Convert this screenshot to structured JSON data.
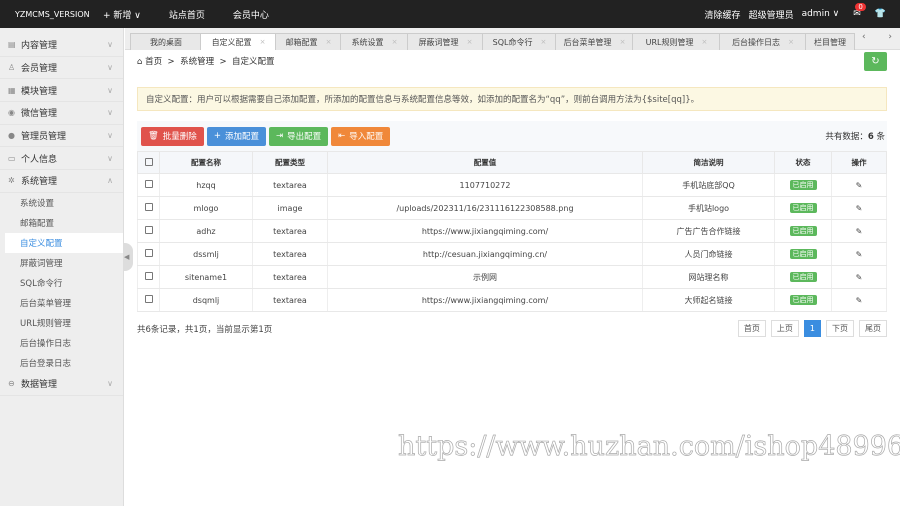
{
  "topbar": {
    "brand": "YZMCMS_VERSION",
    "new_label": "+ 新增 ∨",
    "nav": [
      "站点首页",
      "会员中心"
    ],
    "clear_cache": "清除缓存",
    "role": "超级管理员",
    "user": "admin ∨",
    "msg_count": "0"
  },
  "sidebar": {
    "items": [
      {
        "label": "内容管理",
        "icon": "doc-icon"
      },
      {
        "label": "会员管理",
        "icon": "user-icon"
      },
      {
        "label": "模块管理",
        "icon": "grid-icon"
      },
      {
        "label": "微信管理",
        "icon": "wechat-icon"
      },
      {
        "label": "管理员管理",
        "icon": "admin-icon"
      },
      {
        "label": "个人信息",
        "icon": "card-icon"
      },
      {
        "label": "系统管理",
        "icon": "gear-icon"
      }
    ],
    "sub": [
      "系统设置",
      "邮箱配置",
      "自定义配置",
      "屏蔽词管理",
      "SQL命令行",
      "后台菜单管理",
      "URL规则管理",
      "后台操作日志",
      "后台登录日志"
    ],
    "last": "数据管理"
  },
  "tabs": [
    "我的桌面",
    "自定义配置",
    "邮箱配置",
    "系统设置",
    "屏蔽词管理",
    "SQL命令行",
    "后台菜单管理",
    "URL规则管理",
    "后台操作日志",
    "栏目管理"
  ],
  "breadcrumb": [
    "首页",
    "系统管理",
    "自定义配置"
  ],
  "alert": "自定义配置：用户可以根据需要自己添加配置，所添加的配置信息与系统配置信息等效，如添加的配置名为“qq”，则前台调用方法为{$site[qq]}。",
  "toolbar": {
    "delete": "批量删除",
    "add": "添加配置",
    "export": "导出配置",
    "import": "导入配置",
    "total_label": "共有数据：",
    "total": "6",
    "total_unit": " 条",
    "colors": {
      "delete": "#e0534c",
      "add": "#4a90d9",
      "export": "#5cb85c",
      "import": "#f0883a"
    }
  },
  "table": {
    "headers": [
      "配置名称",
      "配置类型",
      "配置值",
      "简洁说明",
      "状态",
      "操作"
    ],
    "rows": [
      {
        "name": "hzqq",
        "type": "textarea",
        "value": "1107710272",
        "desc": "手机站底部QQ",
        "status": "已启用"
      },
      {
        "name": "mlogo",
        "type": "image",
        "value": "/uploads/202311/16/231116122308588.png",
        "desc": "手机站logo",
        "status": "已启用"
      },
      {
        "name": "adhz",
        "type": "textarea",
        "value": "https://www.jixiangqiming.com/",
        "desc": "广告广告合作链接",
        "status": "已启用"
      },
      {
        "name": "dssmlj",
        "type": "textarea",
        "value": "http://cesuan.jixiangqiming.cn/",
        "desc": "人员门命链接",
        "status": "已启用"
      },
      {
        "name": "sitename1",
        "type": "textarea",
        "value": "示例网",
        "desc": "网站理名称",
        "status": "已启用"
      },
      {
        "name": "dsqmlj",
        "type": "textarea",
        "value": "https://www.jixiangqiming.com/",
        "desc": "大师起名链接",
        "status": "已启用"
      }
    ]
  },
  "pagination": {
    "info": "共6条记录，共1页，当前显示第1页",
    "first": "首页",
    "prev": "上页",
    "current": "1",
    "next": "下页",
    "last": "尾页"
  },
  "watermark": "https://www.huzhan.com/ishop48996"
}
